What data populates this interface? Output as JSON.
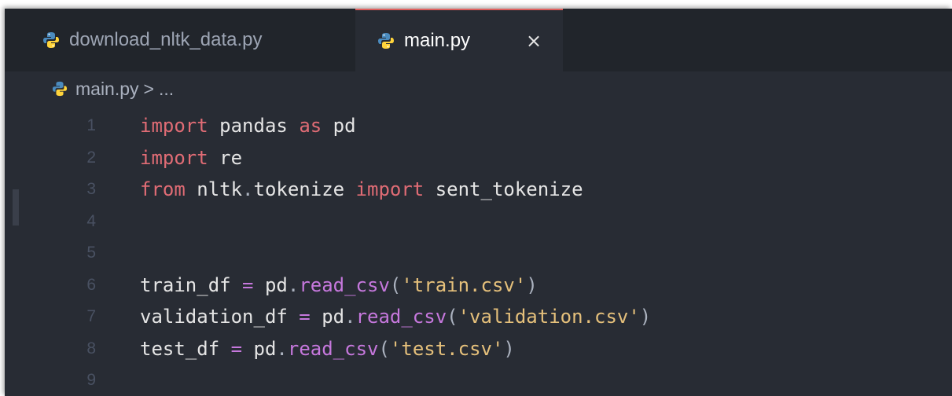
{
  "tabs": [
    {
      "label": "download_nltk_data.py",
      "active": false
    },
    {
      "label": "main.py",
      "active": true,
      "close": "×"
    }
  ],
  "breadcrumb": {
    "file": "main.py",
    "separator": ">",
    "rest": "..."
  },
  "editor": {
    "line_numbers": [
      "1",
      "2",
      "3",
      "4",
      "5",
      "6",
      "7",
      "8",
      "9"
    ],
    "lines": [
      {
        "t": [
          [
            "import",
            "kw"
          ],
          [
            " ",
            "id"
          ],
          [
            "pandas",
            "id"
          ],
          [
            " ",
            "id"
          ],
          [
            "as",
            "kw"
          ],
          [
            " ",
            "id"
          ],
          [
            "pd",
            "id"
          ]
        ]
      },
      {
        "t": [
          [
            "import",
            "kw"
          ],
          [
            " ",
            "id"
          ],
          [
            "re",
            "id"
          ]
        ]
      },
      {
        "t": [
          [
            "from",
            "kw"
          ],
          [
            " ",
            "id"
          ],
          [
            "nltk",
            "id"
          ],
          [
            ".",
            "punc"
          ],
          [
            "tokenize",
            "id"
          ],
          [
            " ",
            "id"
          ],
          [
            "import",
            "kw"
          ],
          [
            " ",
            "id"
          ],
          [
            "sent_tokenize",
            "id"
          ]
        ]
      },
      {
        "t": []
      },
      {
        "t": []
      },
      {
        "t": [
          [
            "train_df",
            "id"
          ],
          [
            " ",
            "id"
          ],
          [
            "=",
            "op"
          ],
          [
            " ",
            "id"
          ],
          [
            "pd",
            "id"
          ],
          [
            ".",
            "punc"
          ],
          [
            "read_csv",
            "fn"
          ],
          [
            "(",
            "punc"
          ],
          [
            "'train.csv'",
            "str"
          ],
          [
            ")",
            "punc"
          ]
        ]
      },
      {
        "t": [
          [
            "validation_df",
            "id"
          ],
          [
            " ",
            "id"
          ],
          [
            "=",
            "op"
          ],
          [
            " ",
            "id"
          ],
          [
            "pd",
            "id"
          ],
          [
            ".",
            "punc"
          ],
          [
            "read_csv",
            "fn"
          ],
          [
            "(",
            "punc"
          ],
          [
            "'validation.csv'",
            "str"
          ],
          [
            ")",
            "punc"
          ]
        ]
      },
      {
        "t": [
          [
            "test_df",
            "id"
          ],
          [
            " ",
            "id"
          ],
          [
            "=",
            "op"
          ],
          [
            " ",
            "id"
          ],
          [
            "pd",
            "id"
          ],
          [
            ".",
            "punc"
          ],
          [
            "read_csv",
            "fn"
          ],
          [
            "(",
            "punc"
          ],
          [
            "'test.csv'",
            "str"
          ],
          [
            ")",
            "punc"
          ]
        ]
      },
      {
        "t": []
      }
    ]
  },
  "colors": {
    "background": "#282c34",
    "tabbar": "#21252b",
    "active_tab_border": "#e0605e",
    "python_icon_blue": "#4b8bbe",
    "python_icon_yellow": "#ffd43b"
  },
  "icons": {
    "file_icon": "python-icon",
    "close_icon": "close-icon"
  }
}
